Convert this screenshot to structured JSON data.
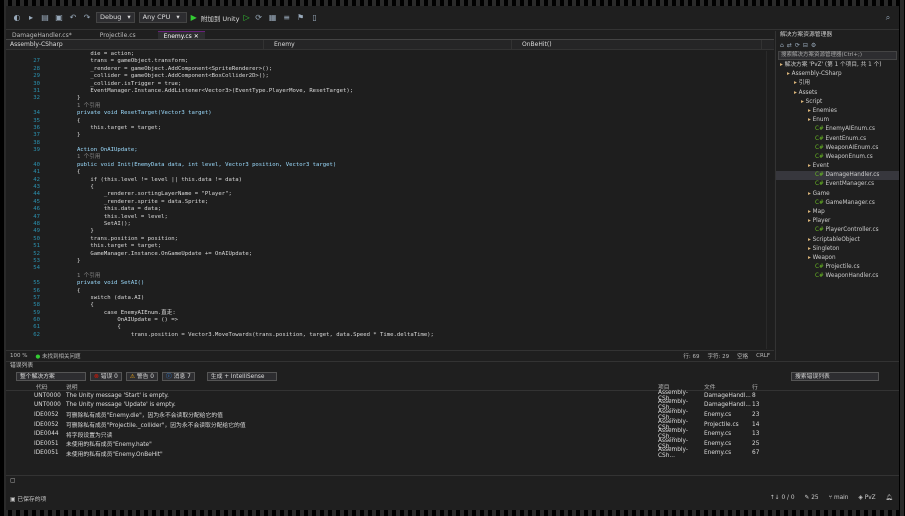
{
  "toolbar": {
    "config": "Debug",
    "platform": "Any CPU",
    "attach": "附加到 Unity"
  },
  "doc_tabs": [
    {
      "label": "DamageHandler.cs*",
      "active": false
    },
    {
      "label": "Projectile.cs",
      "active": false
    },
    {
      "label": "Enemy.cs",
      "active": true
    }
  ],
  "nav": {
    "project": "Assembly-CSharp",
    "type": "Enemy",
    "member": "OnBeHit()"
  },
  "code_lines": [
    {
      "n": "",
      "t": "            die = action;"
    },
    {
      "n": "27",
      "t": "            trans = gameObject.transform;"
    },
    {
      "n": "28",
      "t": "            _renderer = gameObject.AddComponent<SpriteRenderer>();"
    },
    {
      "n": "29",
      "t": "            _collider = gameObject.AddComponent<BoxCollider2D>();"
    },
    {
      "n": "30",
      "t": "            _collider.isTrigger = true;"
    },
    {
      "n": "31",
      "t": "            EventManager.Instance.AddListener<Vector3>(EventType.PlayerMove, ResetTarget);"
    },
    {
      "n": "32",
      "t": "        }"
    },
    {
      "n": "",
      "t": "        1 个引用"
    },
    {
      "n": "34",
      "t": "        private void ResetTarget(Vector3 target)"
    },
    {
      "n": "35",
      "t": "        {"
    },
    {
      "n": "36",
      "t": "            this.target = target;"
    },
    {
      "n": "37",
      "t": "        }"
    },
    {
      "n": "38",
      "t": ""
    },
    {
      "n": "39",
      "t": "        Action OnAIUpdate;"
    },
    {
      "n": "",
      "t": "        1 个引用"
    },
    {
      "n": "40",
      "t": "        public void Init(EnemyData data, int level, Vector3 position, Vector3 target)"
    },
    {
      "n": "41",
      "t": "        {"
    },
    {
      "n": "42",
      "t": "            if (this.level != level || this.data != data)"
    },
    {
      "n": "43",
      "t": "            {"
    },
    {
      "n": "44",
      "t": "                _renderer.sortingLayerName = \"Player\";"
    },
    {
      "n": "45",
      "t": "                _renderer.sprite = data.Sprite;"
    },
    {
      "n": "46",
      "t": "                this.data = data;"
    },
    {
      "n": "47",
      "t": "                this.level = level;"
    },
    {
      "n": "48",
      "t": "                SetAI();"
    },
    {
      "n": "49",
      "t": "            }"
    },
    {
      "n": "50",
      "t": "            trans.position = position;"
    },
    {
      "n": "51",
      "t": "            this.target = target;"
    },
    {
      "n": "52",
      "t": "            GameManager.Instance.OnGameUpdate += OnAIUpdate;"
    },
    {
      "n": "53",
      "t": "        }"
    },
    {
      "n": "54",
      "t": ""
    },
    {
      "n": "",
      "t": "        1 个引用"
    },
    {
      "n": "55",
      "t": "        private void SetAI()"
    },
    {
      "n": "56",
      "t": "        {"
    },
    {
      "n": "57",
      "t": "            switch (data.AI)"
    },
    {
      "n": "58",
      "t": "            {"
    },
    {
      "n": "59",
      "t": "                case EnemyAIEnum.直走:"
    },
    {
      "n": "60",
      "t": "                    OnAIUpdate = () =>"
    },
    {
      "n": "61",
      "t": "                    {"
    },
    {
      "n": "62",
      "t": "                        trans.position = Vector3.MoveTowards(trans.position, target, data.Speed * Time.deltaTime);"
    }
  ],
  "editor_status": {
    "zoom": "100 %",
    "issues": "未找到相关问题",
    "line": "行: 69",
    "char": "字符: 29",
    "spaces": "空格",
    "eol": "CRLF"
  },
  "solution": {
    "title": "解决方案资源管理器",
    "search": "搜索解决方案资源管理器(Ctrl+;)",
    "items": [
      {
        "label": "解决方案 'PvZ' (第 1 个项目, 共 1 个)",
        "indent": 0,
        "sel": false
      },
      {
        "label": "Assembly-CSharp",
        "indent": 1,
        "sel": false
      },
      {
        "label": "引用",
        "indent": 2,
        "sel": false
      },
      {
        "label": "Assets",
        "indent": 2,
        "sel": false
      },
      {
        "label": "Script",
        "indent": 3,
        "sel": false
      },
      {
        "label": "Enemies",
        "indent": 4,
        "sel": false
      },
      {
        "label": "Enum",
        "indent": 4,
        "sel": false
      },
      {
        "label": "EnemyAIEnum.cs",
        "indent": 5,
        "sel": false
      },
      {
        "label": "EventEnum.cs",
        "indent": 5,
        "sel": false
      },
      {
        "label": "WeaponAIEnum.cs",
        "indent": 5,
        "sel": false
      },
      {
        "label": "WeaponEnum.cs",
        "indent": 5,
        "sel": false
      },
      {
        "label": "Event",
        "indent": 4,
        "sel": false
      },
      {
        "label": "DamageHandler.cs",
        "indent": 5,
        "sel": true
      },
      {
        "label": "EventManager.cs",
        "indent": 5,
        "sel": false
      },
      {
        "label": "Game",
        "indent": 4,
        "sel": false
      },
      {
        "label": "GameManager.cs",
        "indent": 5,
        "sel": false
      },
      {
        "label": "Map",
        "indent": 4,
        "sel": false
      },
      {
        "label": "Player",
        "indent": 4,
        "sel": false
      },
      {
        "label": "PlayerController.cs",
        "indent": 5,
        "sel": false
      },
      {
        "label": "ScriptableObject",
        "indent": 4,
        "sel": false
      },
      {
        "label": "Singleton",
        "indent": 4,
        "sel": false
      },
      {
        "label": "Weapon",
        "indent": 4,
        "sel": false
      },
      {
        "label": "Projectile.cs",
        "indent": 5,
        "sel": false
      },
      {
        "label": "WeaponHandler.cs",
        "indent": 5,
        "sel": false
      }
    ]
  },
  "errors": {
    "title": "错误列表",
    "scope": "整个解决方案",
    "err": "错误 0",
    "warn": "警告 0",
    "msg": "消息 7",
    "build": "生成 + IntelliSense",
    "search": "搜索错误列表",
    "headers": {
      "code": "代码",
      "desc": "说明",
      "proj": "项目",
      "file": "文件",
      "line": "行"
    },
    "rows": [
      {
        "code": "UNT0000",
        "desc": "The Unity message 'Start' is empty.",
        "proj": "Assembly-CSh...",
        "file": "DamageHandl...",
        "line": "8"
      },
      {
        "code": "UNT0000",
        "desc": "The Unity message 'Update' is empty.",
        "proj": "Assembly-CSh...",
        "file": "DamageHandl...",
        "line": "13"
      },
      {
        "code": "IDE0052",
        "desc": "可删除私有成员\"Enemy.die\"，因为永不会读取分配给它的值",
        "proj": "Assembly-CSh...",
        "file": "Enemy.cs",
        "line": "23"
      },
      {
        "code": "IDE0052",
        "desc": "可删除私有成员\"Projectile._collider\"，因为永不会读取分配给它的值",
        "proj": "Assembly-CSh...",
        "file": "Projectile.cs",
        "line": "14"
      },
      {
        "code": "IDE0044",
        "desc": "将字段设置为只读",
        "proj": "Assembly-CSh...",
        "file": "Enemy.cs",
        "line": "13"
      },
      {
        "code": "IDE0051",
        "desc": "未使用的私有成员\"Enemy.hate\"",
        "proj": "Assembly-CSh...",
        "file": "Enemy.cs",
        "line": "25"
      },
      {
        "code": "IDE0051",
        "desc": "未使用的私有成员\"Enemy.OnBeHit\"",
        "proj": "Assembly-CSh...",
        "file": "Enemy.cs",
        "line": "67"
      }
    ]
  },
  "bottom_status": {
    "saved": "已保存的项",
    "arrows": "↑↓ 0 / 0",
    "changes": "25",
    "branch": "main",
    "repo": "PvZ"
  },
  "colors": {
    "accent": "#68217a",
    "info": "#3794ff",
    "keyword": "#569cd6",
    "type": "#4ec9b0"
  }
}
